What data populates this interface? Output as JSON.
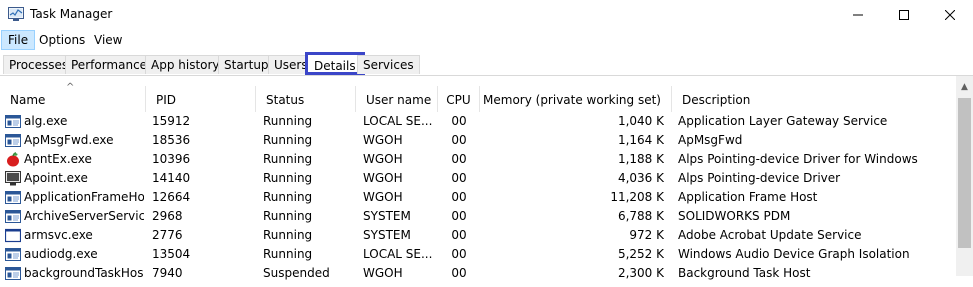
{
  "window": {
    "title": "Task Manager",
    "minimize": "—",
    "maximize": "☐",
    "close": "✕"
  },
  "menu": [
    "File",
    "Options",
    "View"
  ],
  "tabs": [
    "Processes",
    "Performance",
    "App history",
    "Startup",
    "Users",
    "Details",
    "Services"
  ],
  "selected_tab": "Details",
  "columns": {
    "name": "Name",
    "pid": "PID",
    "status": "Status",
    "user": "User name",
    "cpu": "CPU",
    "memory": "Memory (private working set)",
    "description": "Description"
  },
  "sort_indicator": "^",
  "rows": [
    {
      "icon": "service-window-icon",
      "name": "alg.exe",
      "pid": "15912",
      "status": "Running",
      "user": "LOCAL SE...",
      "cpu": "00",
      "memory": "1,040 K",
      "description": "Application Layer Gateway Service"
    },
    {
      "icon": "service-window-icon",
      "name": "ApMsgFwd.exe",
      "pid": "18536",
      "status": "Running",
      "user": "WGOH",
      "cpu": "00",
      "memory": "1,164 K",
      "description": "ApMsgFwd"
    },
    {
      "icon": "apple-icon",
      "name": "ApntEx.exe",
      "pid": "10396",
      "status": "Running",
      "user": "WGOH",
      "cpu": "00",
      "memory": "1,188 K",
      "description": "Alps Pointing-device Driver for Windows"
    },
    {
      "icon": "monitor-icon",
      "name": "Apoint.exe",
      "pid": "14140",
      "status": "Running",
      "user": "WGOH",
      "cpu": "00",
      "memory": "4,036 K",
      "description": "Alps Pointing-device Driver"
    },
    {
      "icon": "service-window-icon",
      "name": "ApplicationFrameHo...",
      "pid": "12664",
      "status": "Running",
      "user": "WGOH",
      "cpu": "00",
      "memory": "11,208 K",
      "description": "Application Frame Host"
    },
    {
      "icon": "service-window-icon",
      "name": "ArchiveServerService...",
      "pid": "2968",
      "status": "Running",
      "user": "SYSTEM",
      "cpu": "00",
      "memory": "6,788 K",
      "description": "SOLIDWORKS PDM"
    },
    {
      "icon": "blank-window-icon",
      "name": "armsvc.exe",
      "pid": "2776",
      "status": "Running",
      "user": "SYSTEM",
      "cpu": "00",
      "memory": "972 K",
      "description": "Adobe Acrobat Update Service"
    },
    {
      "icon": "service-window-icon",
      "name": "audiodg.exe",
      "pid": "13504",
      "status": "Running",
      "user": "LOCAL SE...",
      "cpu": "00",
      "memory": "5,252 K",
      "description": "Windows Audio Device Graph Isolation"
    },
    {
      "icon": "service-window-icon",
      "name": "backgroundTaskHos...",
      "pid": "7940",
      "status": "Suspended",
      "user": "WGOH",
      "cpu": "00",
      "memory": "2,300 K",
      "description": "Background Task Host"
    }
  ]
}
